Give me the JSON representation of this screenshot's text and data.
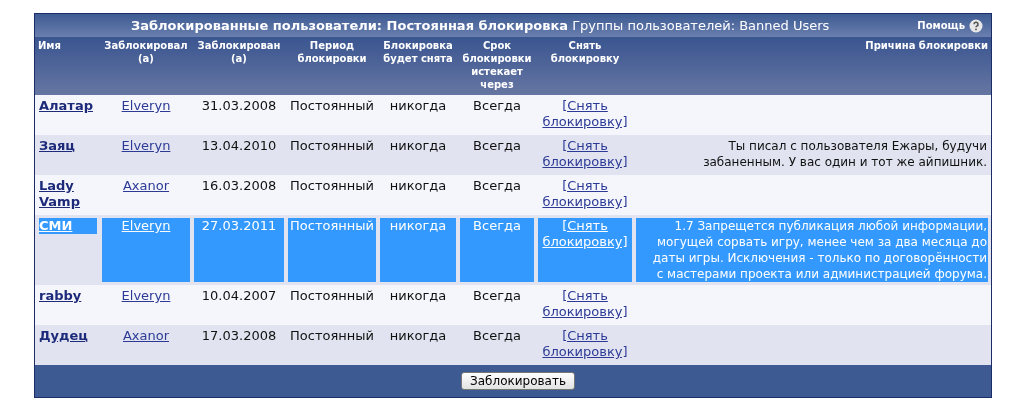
{
  "panel": {
    "title": "Заблокированные пользователи: Постоянная блокировка",
    "subtitle": "Группы пользователей: Banned Users",
    "help": "Помощь"
  },
  "columns": [
    "Имя",
    "Заблокировал (а)",
    "Заблокирован (а)",
    "Период блокировки",
    "Блокировка будет снята",
    "Срок блокировки истекает через",
    "Снять блокировку",
    "Причина блокировки"
  ],
  "rows": [
    {
      "name": "Алатар",
      "banned_by": "Elveryn",
      "date": "31.03.2008",
      "period": "Постоянный",
      "lifted": "никогда",
      "expires": "Всегда",
      "unban": "[Снять блокировку]",
      "reason": "",
      "selected": false
    },
    {
      "name": "Заяц",
      "banned_by": "Elveryn",
      "date": "13.04.2010",
      "period": "Постоянный",
      "lifted": "никогда",
      "expires": "Всегда",
      "unban": "[Снять блокировку]",
      "reason": "Ты писал с пользователя Ежары, будучи забаненным. У вас один и тот же айпишник.",
      "selected": false
    },
    {
      "name": "Lady Vamp",
      "banned_by": "Axanor",
      "date": "16.03.2008",
      "period": "Постоянный",
      "lifted": "никогда",
      "expires": "Всегда",
      "unban": "[Снять блокировку]",
      "reason": "",
      "selected": false
    },
    {
      "name": "СМИ",
      "banned_by": "Elveryn",
      "date": "27.03.2011",
      "period": "Постоянный",
      "lifted": "никогда",
      "expires": "Всегда",
      "unban": "[Снять блокировку]",
      "reason": "1.7 Запрещется публикация любой информации, могущей сорвать игру, менее чем за два месяца до даты игры. Исключения - только по договорённости с мастерами проекта или администрацией форума.",
      "selected": true
    },
    {
      "name": "rabby",
      "banned_by": "Elveryn",
      "date": "10.04.2007",
      "period": "Постоянный",
      "lifted": "никогда",
      "expires": "Всегда",
      "unban": "[Снять блокировку]",
      "reason": "",
      "selected": false
    },
    {
      "name": "Дудец",
      "banned_by": "Axanor",
      "date": "17.03.2008",
      "period": "Постоянный",
      "lifted": "никогда",
      "expires": "Всегда",
      "unban": "[Снять блокировку]",
      "reason": "",
      "selected": false
    }
  ],
  "button": "Заблокировать"
}
